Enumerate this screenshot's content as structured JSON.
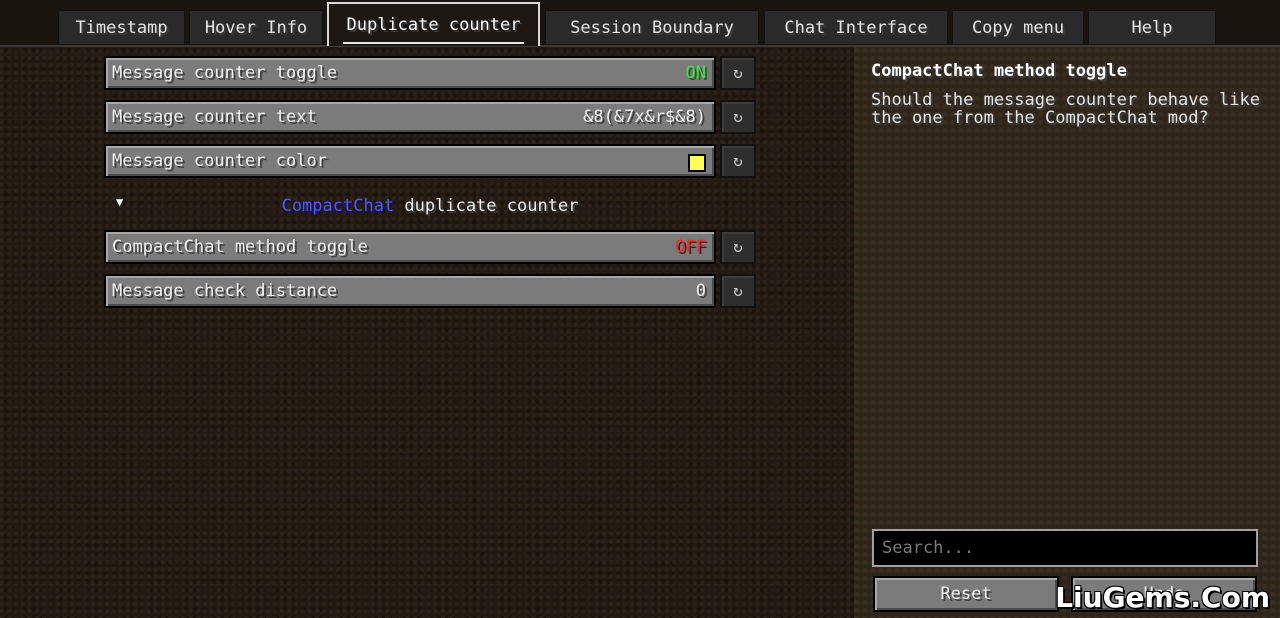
{
  "tabs": [
    {
      "label": "Timestamp"
    },
    {
      "label": "Hover Info"
    },
    {
      "label": "Duplicate counter",
      "active": true
    },
    {
      "label": "Session Boundary"
    },
    {
      "label": "Chat Interface"
    },
    {
      "label": "Copy menu"
    },
    {
      "label": "Help"
    }
  ],
  "options": [
    {
      "label": "Message counter toggle",
      "value": "ON"
    },
    {
      "label": "Message counter text",
      "value": "&8(&7x&r$&8)"
    },
    {
      "label": "Message counter color",
      "swatch_color": "#ffff55"
    },
    {
      "label": "CompactChat method toggle",
      "value": "OFF"
    },
    {
      "label": "Message check distance",
      "value": "0"
    }
  ],
  "reset_glyph": "↻",
  "category": {
    "arrow_glyph": "▼",
    "title_part1": "CompactChat",
    "title_part2": " duplicate counter"
  },
  "info": {
    "title": "CompactChat method toggle",
    "description": "Should the message counter behave like the one from the CompactChat mod?"
  },
  "search": {
    "placeholder": "Search..."
  },
  "buttons": {
    "reset_label": "Reset",
    "undo_label": "Undo"
  },
  "watermark": "LiuGems.Com",
  "colors": {
    "on": "#4fd84f",
    "off": "#e03333",
    "link_blue": "#5555ff"
  }
}
